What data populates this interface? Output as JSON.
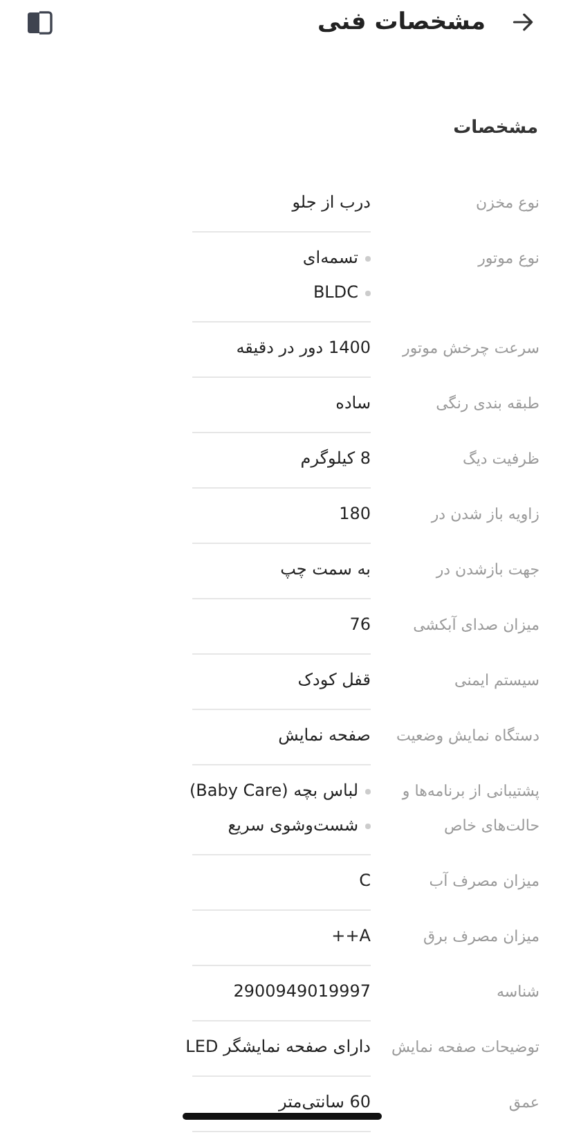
{
  "header": {
    "title": "مشخصات فنی"
  },
  "section": {
    "title": "مشخصات"
  },
  "rows": [
    {
      "label": "نوع مخزن",
      "kind": "text",
      "values": [
        "درب از جلو"
      ]
    },
    {
      "label": "نوع موتور",
      "kind": "list",
      "values": [
        "تسمه‌ای",
        "BLDC"
      ]
    },
    {
      "label": "سرعت چرخش موتور",
      "kind": "text",
      "values": [
        "1400 دور در دقیقه"
      ]
    },
    {
      "label": "طبقه بندی رنگی",
      "kind": "text",
      "values": [
        "ساده"
      ]
    },
    {
      "label": "ظرفیت دیگ",
      "kind": "text",
      "values": [
        "8 کیلوگرم"
      ]
    },
    {
      "label": "زاویه باز شدن در",
      "kind": "text",
      "values": [
        "180"
      ]
    },
    {
      "label": "جهت بازشدن در",
      "kind": "text",
      "values": [
        "به سمت چپ"
      ]
    },
    {
      "label": "میزان صدای آبکشی",
      "kind": "text",
      "values": [
        "76"
      ]
    },
    {
      "label": "سیستم ایمنی",
      "kind": "text",
      "values": [
        "قفل کودک"
      ]
    },
    {
      "label": "دستگاه نمایش وضعیت",
      "kind": "text",
      "values": [
        "صفحه نمایش"
      ]
    },
    {
      "label": "پشتیبانی از برنامه‌ها و حالت‌های خاص",
      "kind": "list",
      "values": [
        "لباس بچه (Baby Care)",
        "شست‌وشوی سریع"
      ]
    },
    {
      "label": "میزان مصرف آب",
      "kind": "text",
      "values": [
        "C"
      ]
    },
    {
      "label": "میزان مصرف برق",
      "kind": "text",
      "values": [
        "A++"
      ]
    },
    {
      "label": "شناسه",
      "kind": "text",
      "values": [
        "2900949019997"
      ]
    },
    {
      "label": "توضیحات صفحه نمایش",
      "kind": "text",
      "values": [
        "دارای صفحه نمایشگر LED"
      ]
    },
    {
      "label": "عمق",
      "kind": "text",
      "values": [
        "60 سانتی‌متر"
      ]
    }
  ]
}
